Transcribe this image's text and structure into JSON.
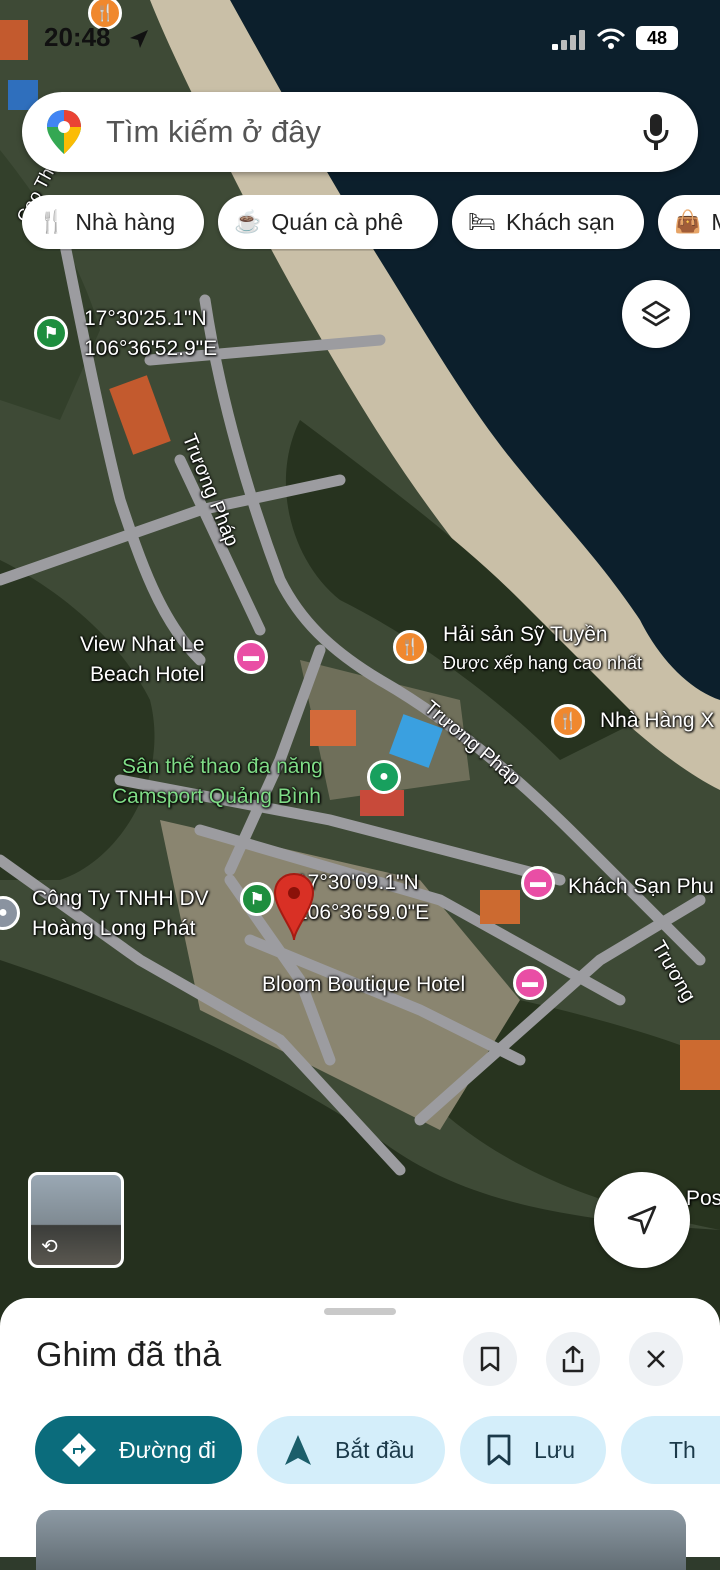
{
  "status_bar": {
    "time": "20:48",
    "battery": "48"
  },
  "search": {
    "placeholder": "Tìm kiếm ở đây"
  },
  "chips": [
    {
      "label": "Nhà hàng",
      "icon": "fork-knife-icon"
    },
    {
      "label": "Quán cà phê",
      "icon": "coffee-icon"
    },
    {
      "label": "Khách sạn",
      "icon": "bed-icon"
    },
    {
      "label": "M",
      "icon": "shopping-bag-icon"
    }
  ],
  "map": {
    "streets": [
      "Trương Pháp",
      "Trương Pháp",
      "Trương",
      "Cao Th"
    ],
    "markers": {
      "flag1": {
        "lat": "17°30'25.1\"N",
        "lng": "106°36'52.9\"E"
      },
      "flag2": {
        "lat": "17°30'09.1\"N",
        "lng": "106°36'59.0\"E"
      }
    },
    "places": {
      "view_hotel_line1": "View Nhat Le",
      "view_hotel_line2": "Beach Hotel",
      "haisan_name": "Hải sản Sỹ Tuyền",
      "haisan_sub": "Được xếp hạng cao nhất",
      "nhahang": "Nhà Hàng X",
      "camsport_line1": "Sân thể thao đa năng",
      "camsport_line2": "Camsport Quảng Bình",
      "congty_line1": "Công Ty TNHH DV",
      "congty_line2": "Hoàng Long Phát",
      "khachsan": "Khách Sạn Phu",
      "bloom": "Bloom Boutique Hotel",
      "pos": "Pos"
    },
    "colors": {
      "hotel": "#e94ea5",
      "restaurant": "#f0882e",
      "flag": "#1e8e3e",
      "pin": "#d93025",
      "sport": "#18a05e"
    }
  },
  "sheet": {
    "title": "Ghim đã thả",
    "actions": [
      {
        "label": "Đường đi",
        "icon": "directions-icon"
      },
      {
        "label": "Bắt đầu",
        "icon": "navigation-arrow-icon"
      },
      {
        "label": "Lưu",
        "icon": "bookmark-icon"
      },
      {
        "label": "Th",
        "icon": "flag-icon"
      }
    ]
  }
}
